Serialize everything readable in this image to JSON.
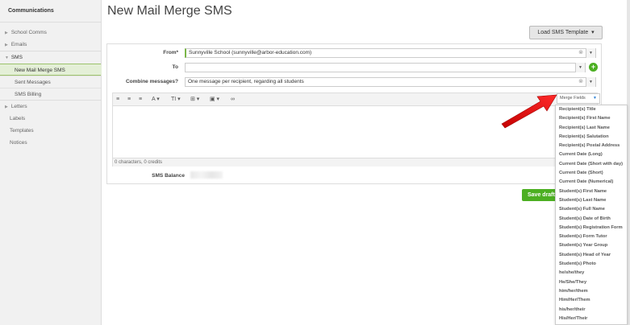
{
  "sidebar": {
    "title": "Communications",
    "items": [
      {
        "label": "School Comms",
        "caret": "▶"
      },
      {
        "label": "Emails",
        "caret": "▶"
      }
    ],
    "sms": {
      "label": "SMS",
      "caret": "▼",
      "children": [
        "New Mail Merge SMS",
        "Sent Messages",
        "SMS Billing"
      ]
    },
    "after": [
      {
        "label": "Letters",
        "caret": "▶"
      },
      {
        "label": "Labels"
      },
      {
        "label": "Templates"
      },
      {
        "label": "Notices"
      }
    ]
  },
  "main": {
    "title": "New Mail Merge SMS",
    "load_template_label": "Load SMS Template",
    "from_label": "From*",
    "from_value": "Sunnyville School (sunnyville@arbor-education.com)",
    "to_label": "To",
    "to_value": "",
    "combine_label": "Combine messages?",
    "combine_value": "One message per recipient, regarding all students",
    "editor_footer": "0 characters, 0 credits",
    "sms_balance_label": "SMS Balance",
    "save_label": "Save draft",
    "merge_fields_label": "Merge Fields"
  },
  "merge_fields": [
    "Recipient(s) Title",
    "Recipient(s) First Name",
    "Recipient(s) Last Name",
    "Recipient(s) Salutation",
    "Recipient(s) Postal Address",
    "Current Date (Long)",
    "Current Date (Short with day)",
    "Current Date (Short)",
    "Current Date (Numerical)",
    "Student(s) First Name",
    "Student(s) Last Name",
    "Student(s) Full Name",
    "Student(s) Date of Birth",
    "Student(s) Registration Form",
    "Student(s) Form Tutor",
    "Student(s) Year Group",
    "Student(s) Head of Year",
    "Student(s) Photo",
    "he/she/they",
    "He/She/They",
    "him/her/them",
    "Him/Her/Them",
    "his/her/their",
    "His/Her/Their"
  ],
  "colors": {
    "accent_green": "#4caf22",
    "active_nav": "#e4efd7",
    "annotation_red": "#e02020"
  }
}
